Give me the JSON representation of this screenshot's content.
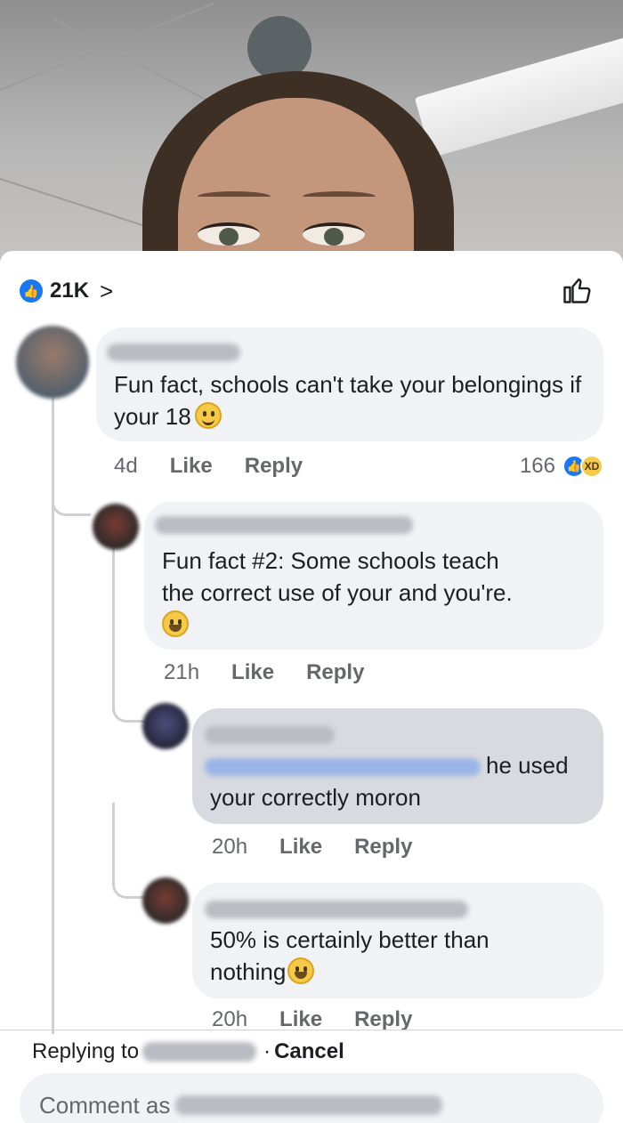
{
  "reactions": {
    "total": "21K"
  },
  "comments": [
    {
      "text": "Fun fact, schools can't take your belongings if your 18",
      "time": "4d",
      "like": "Like",
      "reply": "Reply",
      "reaction_count": "166"
    },
    {
      "text_line1": "Fun fact #2: Some schools teach",
      "text_line2": "the correct use of your and you're.",
      "time": "21h",
      "like": "Like",
      "reply": "Reply"
    },
    {
      "text_line1": "he used",
      "text_line2": "your correctly moron",
      "time": "20h",
      "like": "Like",
      "reply": "Reply"
    },
    {
      "text_line1": "50% is certainly better than",
      "text_line2": "nothing",
      "time": "20h",
      "like": "Like",
      "reply": "Reply"
    }
  ],
  "composer": {
    "replying_to": "Replying to",
    "cancel": "Cancel",
    "placeholder": "Comment as"
  },
  "colors": {
    "accent": "#1877f2",
    "bubble": "#f0f2f5",
    "muted": "#65676b"
  }
}
